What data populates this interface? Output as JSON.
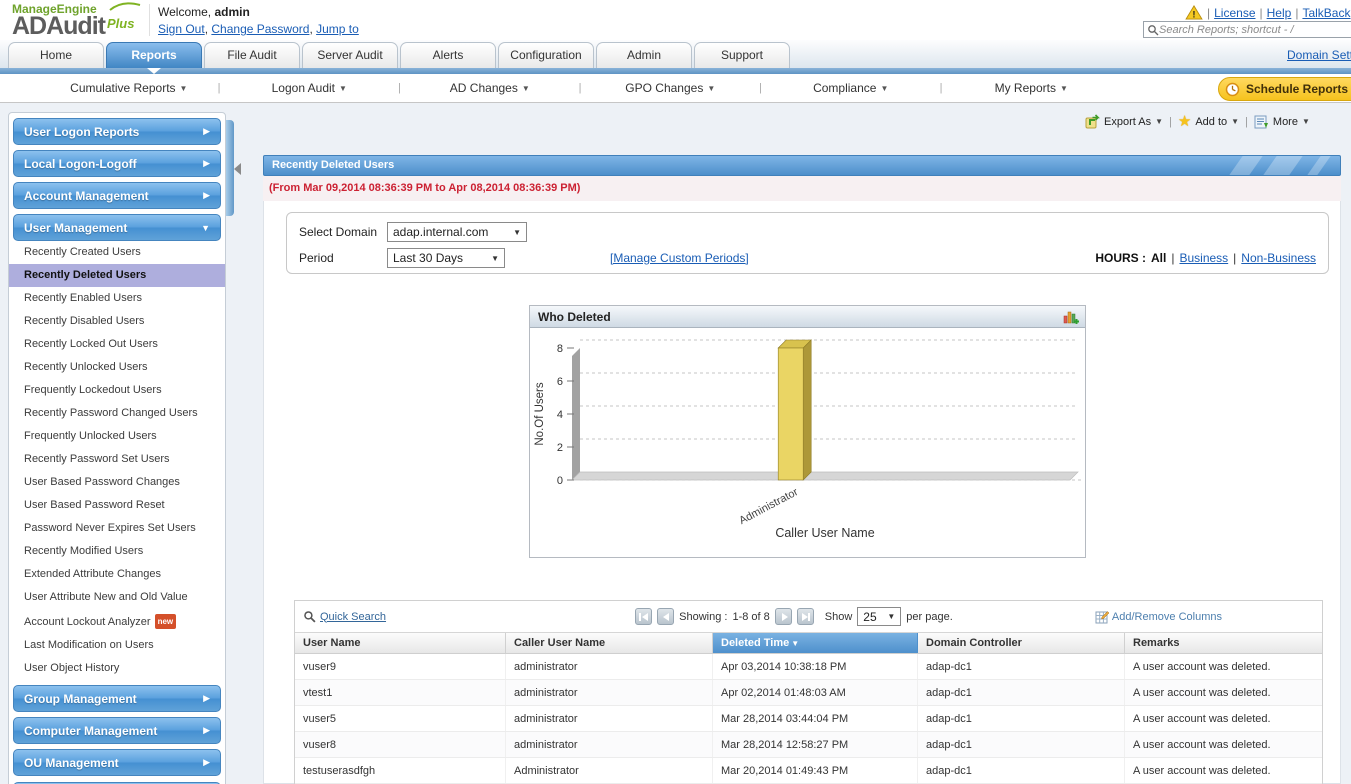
{
  "header": {
    "brand": "ManageEngine",
    "product": "ADAudit",
    "product_suffix": "Plus",
    "welcome": "Welcome,",
    "username": "admin",
    "session_links": [
      "Sign Out",
      "Change Password",
      "Jump to"
    ],
    "top_links": [
      "License",
      "Help",
      "TalkBack"
    ],
    "search_placeholder": "Search Reports; shortcut - /"
  },
  "tabs": {
    "items": [
      "Home",
      "Reports",
      "File Audit",
      "Server Audit",
      "Alerts",
      "Configuration",
      "Admin",
      "Support"
    ],
    "active": "Reports",
    "right_link": "Domain Settings"
  },
  "subnav": {
    "items": [
      "Cumulative Reports",
      "Logon Audit",
      "AD Changes",
      "GPO Changes",
      "Compliance",
      "My Reports"
    ],
    "schedule_button": "Schedule Reports"
  },
  "sidebar": {
    "selected": "Recently Deleted Users",
    "sections": [
      {
        "label": "User Logon Reports",
        "expanded": false
      },
      {
        "label": "Local Logon-Logoff",
        "expanded": false
      },
      {
        "label": "Account Management",
        "expanded": false
      },
      {
        "label": "User Management",
        "expanded": true,
        "items": [
          {
            "label": "Recently Created Users"
          },
          {
            "label": "Recently Deleted Users"
          },
          {
            "label": "Recently Enabled Users"
          },
          {
            "label": "Recently Disabled Users"
          },
          {
            "label": "Recently Locked Out Users"
          },
          {
            "label": "Recently Unlocked Users"
          },
          {
            "label": "Frequently Lockedout Users"
          },
          {
            "label": "Recently Password Changed Users"
          },
          {
            "label": "Frequently Unlocked Users"
          },
          {
            "label": "Recently Password Set Users"
          },
          {
            "label": "User Based Password Changes"
          },
          {
            "label": "User Based Password Reset"
          },
          {
            "label": "Password Never Expires Set Users"
          },
          {
            "label": "Recently Modified Users"
          },
          {
            "label": "Extended Attribute Changes"
          },
          {
            "label": "User Attribute New and Old Value"
          },
          {
            "label": "Account Lockout Analyzer",
            "badge": "new"
          },
          {
            "label": "Last Modification on Users"
          },
          {
            "label": "User Object History"
          }
        ]
      },
      {
        "label": "Group Management",
        "expanded": false
      },
      {
        "label": "Computer Management",
        "expanded": false
      },
      {
        "label": "OU Management",
        "expanded": false
      }
    ]
  },
  "actions": {
    "export": "Export As",
    "add_to": "Add to",
    "more": "More"
  },
  "report": {
    "title": "Recently Deleted Users",
    "date_range": "(From Mar 09,2014 08:36:39 PM to Apr 08,2014 08:36:39 PM)",
    "domain_label": "Select Domain",
    "domain_value": "adap.internal.com",
    "period_label": "Period",
    "period_value": "Last 30 Days",
    "manage_periods_link": "[Manage Custom Periods]",
    "hours_label": "HOURS :",
    "hours_active": "All",
    "hours_links": [
      "Business",
      "Non-Business"
    ]
  },
  "chart_data": {
    "type": "bar",
    "title": "Who Deleted",
    "categories": [
      "Administrator"
    ],
    "values": [
      8
    ],
    "xlabel": "Caller User Name",
    "ylabel": "No.Of Users",
    "ylim": [
      0,
      8
    ],
    "yticks": [
      0,
      2,
      4,
      6,
      8
    ],
    "grid": true,
    "legend": false,
    "bar_color": "#EAD564"
  },
  "grid": {
    "quick_search": "Quick Search",
    "showing_label": "Showing :",
    "showing_range": "1-8 of 8",
    "show_label": "Show",
    "page_size": "25",
    "per_page": "per page.",
    "add_remove_columns": "Add/Remove Columns",
    "columns": [
      "User Name",
      "Caller User Name",
      "Deleted Time",
      "Domain Controller",
      "Remarks"
    ],
    "sorted_column": "Deleted Time",
    "rows": [
      [
        "vuser9",
        "administrator",
        "Apr 03,2014 10:38:18 PM",
        "adap-dc1",
        "A user account was deleted."
      ],
      [
        "vtest1",
        "administrator",
        "Apr 02,2014 01:48:03 AM",
        "adap-dc1",
        "A user account was deleted."
      ],
      [
        "vuser5",
        "administrator",
        "Mar 28,2014 03:44:04 PM",
        "adap-dc1",
        "A user account was deleted."
      ],
      [
        "vuser8",
        "administrator",
        "Mar 28,2014 12:58:27 PM",
        "adap-dc1",
        "A user account was deleted."
      ],
      [
        "testuserasdfgh",
        "Administrator",
        "Mar 20,2014 01:49:43 PM",
        "adap-dc1",
        "A user account was deleted."
      ]
    ]
  },
  "colors": {
    "accent_blue": "#4E90CC",
    "selected_item_bg": "#AEAEDD",
    "schedule_yellow": "#F6C31D",
    "date_red": "#CC2233",
    "link_blue": "#1A5DB5",
    "bar_yellow": "#EAD564"
  }
}
